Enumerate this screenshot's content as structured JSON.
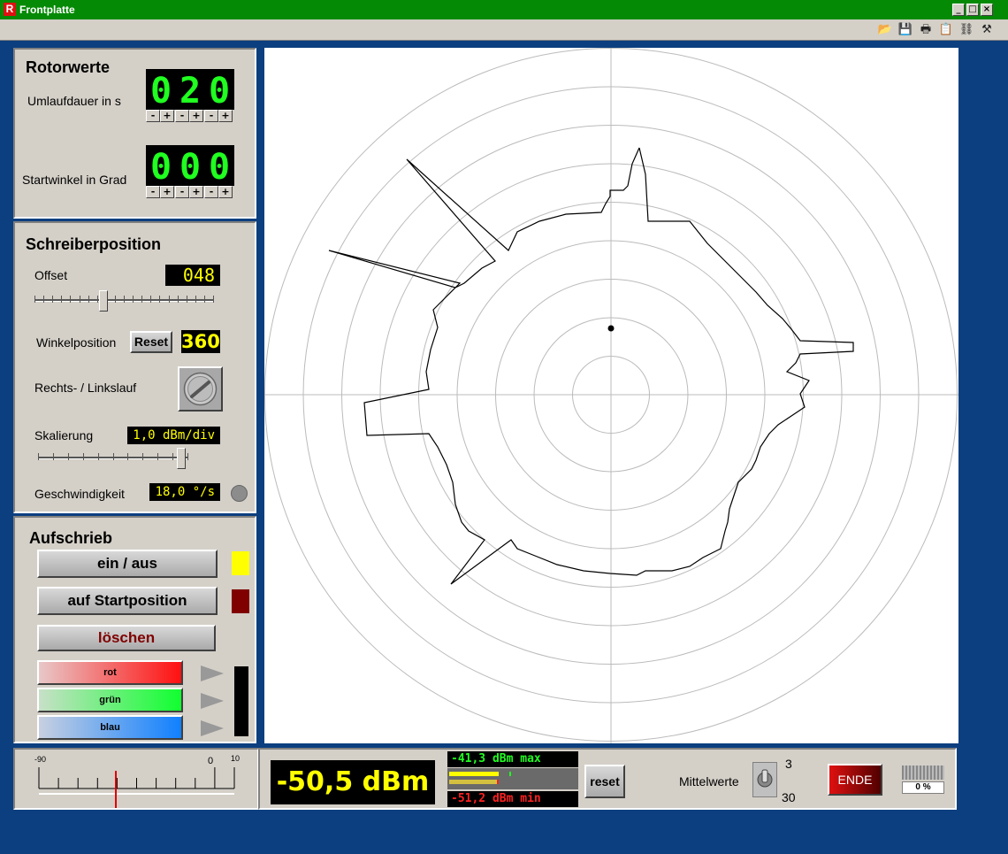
{
  "window": {
    "title": "Frontplatte",
    "app_icon": "R"
  },
  "rotor": {
    "title": "Rotorwerte",
    "umlauf_label": "Umlaufdauer in s",
    "umlauf_digits": [
      "0",
      "2",
      "0"
    ],
    "start_label": "Startwinkel in Grad",
    "start_digits": [
      "0",
      "0",
      "0"
    ],
    "minus": "-",
    "plus": "+"
  },
  "schreiber": {
    "title": "Schreiberposition",
    "offset_label": "Offset",
    "offset_value": "048",
    "offset_level": 0.38,
    "winkel_label": "Winkelposition",
    "reset_label": "Reset",
    "winkel_value": "360",
    "richtung_label": "Rechts- / Linkslauf",
    "skalierung_label": "Skalierung",
    "skalierung_value": "1,0 dBm/div",
    "skalierung_level": 0.98,
    "geschw_label": "Geschwindigkeit",
    "geschw_value": "18,0 °/s"
  },
  "aufschrieb": {
    "title": "Aufschrieb",
    "ein_aus": "ein / aus",
    "startpos": "auf Startposition",
    "loeschen": "löschen",
    "rot": "rot",
    "gruen": "grün",
    "blau": "blau"
  },
  "meter": {
    "min": "-90",
    "zero": "0",
    "max": "10"
  },
  "level": {
    "value": "-50,5 dBm",
    "max_text": "-41,3 dBm max",
    "min_text": "-51,2 dBm min",
    "reset": "reset"
  },
  "mittelwerte": {
    "label": "Mittelwerte",
    "opt_a": "3",
    "opt_b": "30"
  },
  "ende": "ENDE",
  "progress": {
    "text": "0 %",
    "value": 0
  },
  "colors": {
    "accent_green": "#20ff20",
    "display_yellow": "#ffff00",
    "min_red": "#ff2020",
    "led_yellow": "#ffff00",
    "led_darkred": "#800000"
  },
  "icons": [
    "open-icon",
    "save-icon",
    "print-icon",
    "clipboard-icon",
    "link-icon",
    "tools-icon"
  ]
}
